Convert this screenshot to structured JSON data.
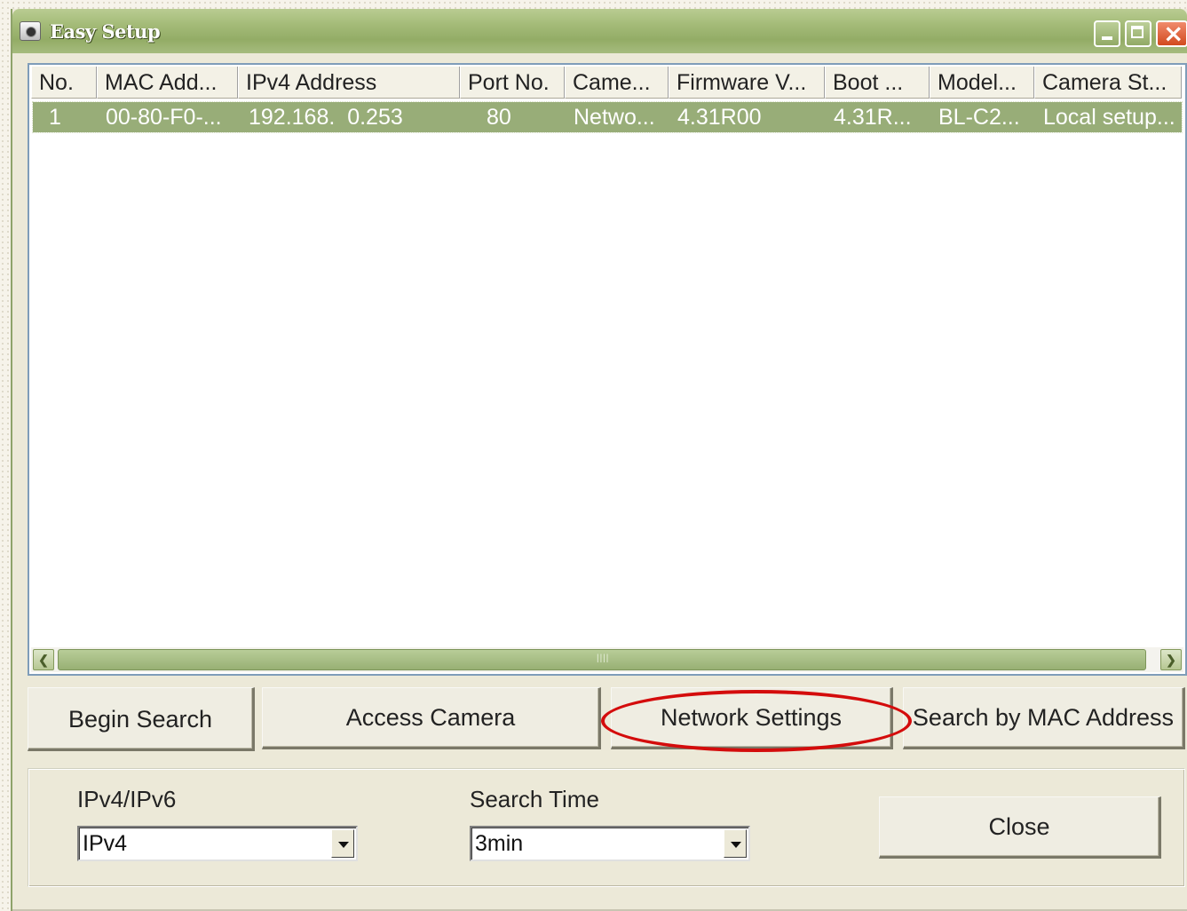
{
  "window": {
    "title": "Easy Setup",
    "controls": {
      "minimize": "minimize",
      "maximize": "maximize",
      "close": "close"
    }
  },
  "list": {
    "columns": [
      {
        "label": "No."
      },
      {
        "label": "MAC Add..."
      },
      {
        "label": "IPv4 Address"
      },
      {
        "label": "Port No."
      },
      {
        "label": "Came..."
      },
      {
        "label": "Firmware V..."
      },
      {
        "label": "Boot ..."
      },
      {
        "label": "Model..."
      },
      {
        "label": "Camera St..."
      }
    ],
    "rows": [
      {
        "cells": [
          "1",
          "00-80-F0-...",
          "192.168.  0.253",
          "80",
          "Netwo...",
          "4.31R00",
          "4.31R...",
          "BL-C2...",
          "Local setup..."
        ]
      }
    ]
  },
  "buttons": {
    "begin_search": "Begin Search",
    "access_camera": "Access Camera",
    "network_settings": "Network Settings",
    "search_by_mac": "Search by MAC Address",
    "close": "Close"
  },
  "options": {
    "ip_version_label": "IPv4/IPv6",
    "ip_version_value": "IPv4",
    "search_time_label": "Search Time",
    "search_time_value": "3min"
  },
  "colors": {
    "titlebar": "#a4bb78",
    "selection": "#98ad78",
    "highlight_ring": "#d40c0c"
  }
}
